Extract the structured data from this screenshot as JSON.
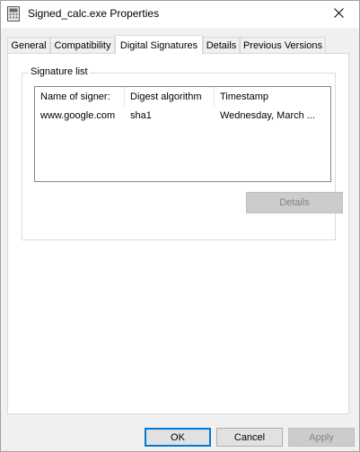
{
  "window": {
    "title": "Signed_calc.exe Properties"
  },
  "tabs": [
    {
      "label": "General",
      "active": false
    },
    {
      "label": "Compatibility",
      "active": false
    },
    {
      "label": "Digital Signatures",
      "active": true
    },
    {
      "label": "Details",
      "active": false
    },
    {
      "label": "Previous Versions",
      "active": false
    }
  ],
  "signature_group": {
    "title": "Signature list",
    "columns": [
      "Name of signer:",
      "Digest algorithm",
      "Timestamp"
    ],
    "rows": [
      [
        "www.google.com",
        "sha1",
        "Wednesday, March ..."
      ]
    ],
    "details_button": "Details",
    "details_enabled": false
  },
  "buttons": {
    "ok": "OK",
    "cancel": "Cancel",
    "apply": "Apply",
    "apply_enabled": false
  },
  "colors": {
    "focus_border": "#0078d7",
    "disabled_text": "#838383"
  }
}
